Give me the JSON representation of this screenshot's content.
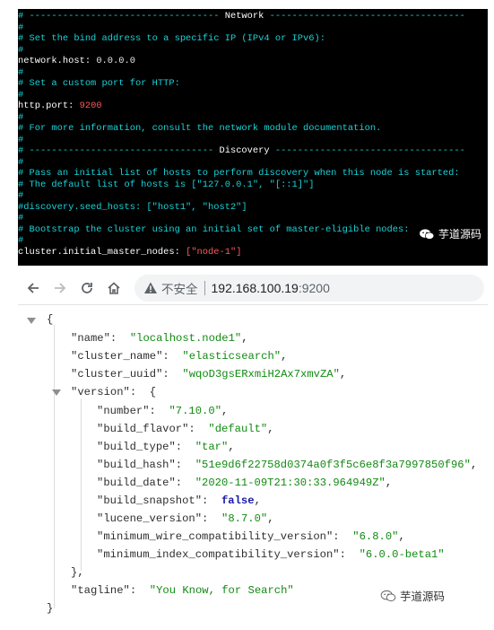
{
  "terminal": {
    "lines": [
      {
        "kind": "header",
        "text": "# ---------------------------------- Network -----------------------------------"
      },
      {
        "kind": "comment",
        "text": "#"
      },
      {
        "kind": "comment",
        "text": "# Set the bind address to a specific IP (IPv4 or IPv6):"
      },
      {
        "kind": "comment",
        "text": "#"
      },
      {
        "kind": "setting",
        "key": "network.host",
        "value": "0.0.0.0",
        "style": "plain"
      },
      {
        "kind": "comment",
        "text": "#"
      },
      {
        "kind": "comment",
        "text": "# Set a custom port for HTTP:"
      },
      {
        "kind": "comment",
        "text": "#"
      },
      {
        "kind": "setting",
        "key": "http.port",
        "value": "9200",
        "style": "num"
      },
      {
        "kind": "comment",
        "text": "#"
      },
      {
        "kind": "comment",
        "text": "# For more information, consult the network module documentation."
      },
      {
        "kind": "comment",
        "text": "#"
      },
      {
        "kind": "header",
        "text": "# --------------------------------- Discovery ----------------------------------"
      },
      {
        "kind": "comment",
        "text": "#"
      },
      {
        "kind": "comment",
        "text": "# Pass an initial list of hosts to perform discovery when this node is started:"
      },
      {
        "kind": "comment",
        "text": "# The default list of hosts is [\"127.0.0.1\", \"[::1]\"]"
      },
      {
        "kind": "comment",
        "text": "#"
      },
      {
        "kind": "comment",
        "text": "#discovery.seed_hosts: [\"host1\", \"host2\"]"
      },
      {
        "kind": "comment",
        "text": "#"
      },
      {
        "kind": "comment",
        "text": "# Bootstrap the cluster using an initial set of master-eligible nodes:"
      },
      {
        "kind": "comment",
        "text": "#"
      },
      {
        "kind": "setting",
        "key": "cluster.initial_master_nodes",
        "value": "[\"node-1\"]",
        "style": "str"
      }
    ],
    "watermark": "芋道源码"
  },
  "browser": {
    "back_icon": "arrow-left-icon",
    "forward_icon": "arrow-right-icon",
    "reload_icon": "reload-icon",
    "home_icon": "home-icon",
    "security_label": "不安全",
    "url_host": "192.168.100.19",
    "url_port": ":9200"
  },
  "json": {
    "name": "localhost.node1",
    "cluster_name": "elasticsearch",
    "cluster_uuid": "wqoD3gsERxmiH2Ax7xmvZA",
    "version": {
      "number": "7.10.0",
      "build_flavor": "default",
      "build_type": "tar",
      "build_hash": "51e9d6f22758d0374a0f3f5c6e8f3a7997850f96",
      "build_date": "2020-11-09T21:30:33.964949Z",
      "build_snapshot": "false",
      "lucene_version": "8.7.0",
      "minimum_wire_compatibility_version": "6.8.0",
      "minimum_index_compatibility_version": "6.0.0-beta1"
    },
    "tagline": "You Know, for Search"
  },
  "watermark_bottom": "芋道源码",
  "colors": {
    "terminal_bg": "#000000",
    "comment": "#19d3d8",
    "value_red": "#ff5a5a",
    "json_string": "#128a12",
    "json_bool": "#1a1aa6"
  }
}
